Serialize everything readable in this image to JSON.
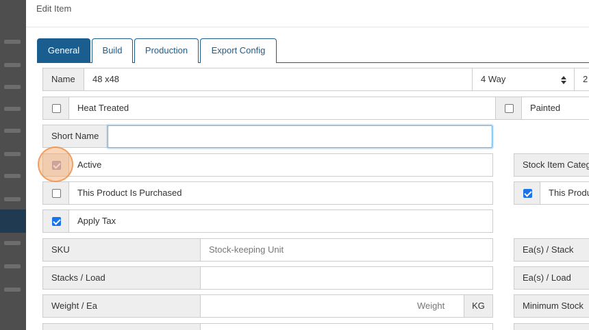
{
  "modal": {
    "title": "Edit Item"
  },
  "tabs": [
    {
      "label": "General",
      "active": true
    },
    {
      "label": "Build",
      "active": false
    },
    {
      "label": "Production",
      "active": false
    },
    {
      "label": "Export Config",
      "active": false
    }
  ],
  "form": {
    "name": {
      "label": "Name",
      "value": "48 x48"
    },
    "way_select": {
      "value": "4 Way"
    },
    "extra_value": "2",
    "heat_treated": {
      "label": "Heat Treated",
      "checked": false
    },
    "painted": {
      "label": "Painted",
      "checked": false
    },
    "short_name": {
      "label": "Short Name",
      "value": ""
    },
    "active": {
      "label": "Active",
      "checked": true
    },
    "stock_item_category": {
      "label": "Stock Item Categ"
    },
    "purchased": {
      "label": "This Product Is Purchased",
      "checked": false
    },
    "this_product_right": {
      "label": "This Produ",
      "checked": true
    },
    "apply_tax": {
      "label": "Apply Tax",
      "checked": true
    },
    "sku": {
      "label": "SKU",
      "placeholder": "Stock-keeping Unit"
    },
    "ea_stack": {
      "label": "Ea(s) / Stack"
    },
    "stacks_load": {
      "label": "Stacks / Load",
      "value": ""
    },
    "ea_load": {
      "label": "Ea(s) / Load"
    },
    "weight_ea": {
      "label": "Weight / Ea",
      "placeholder": "Weight",
      "unit": "KG"
    },
    "minimum_stock": {
      "label": "Minimum Stock"
    }
  },
  "colors": {
    "primary": "#1a5d8f",
    "checkbox": "#1a73e8",
    "focus": "#66afe9"
  }
}
